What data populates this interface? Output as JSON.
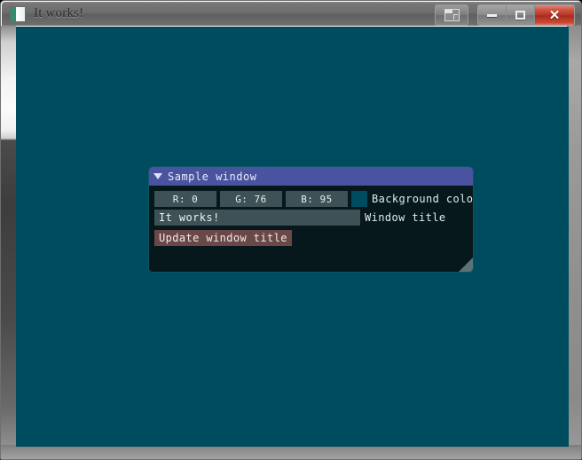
{
  "os_window": {
    "title": "It works!",
    "icon": "app-icon",
    "buttons": {
      "restore_group_label": "restore-window",
      "minimize_label": "–",
      "maximize_label": "□",
      "close_label": "✕"
    }
  },
  "client": {
    "background_color": "#004C5F"
  },
  "imgui_window": {
    "title": "Sample window",
    "collapse_icon": "triangle-down-icon",
    "background_color": "#06181C",
    "titlebar_color": "#4A53A0",
    "sliders": [
      {
        "name": "red",
        "label": "R:   0",
        "value": 0
      },
      {
        "name": "green",
        "label": "G: 76",
        "value": 76
      },
      {
        "name": "blue",
        "label": "B: 95",
        "value": 95
      }
    ],
    "color_swatch": {
      "color": "#004C5F",
      "label": "Background color"
    },
    "title_field": {
      "value": "It works!",
      "label": "Window title"
    },
    "update_button": {
      "label": "Update window title",
      "color": "#6B4848"
    },
    "resize_grip": "resize-grip-icon"
  }
}
